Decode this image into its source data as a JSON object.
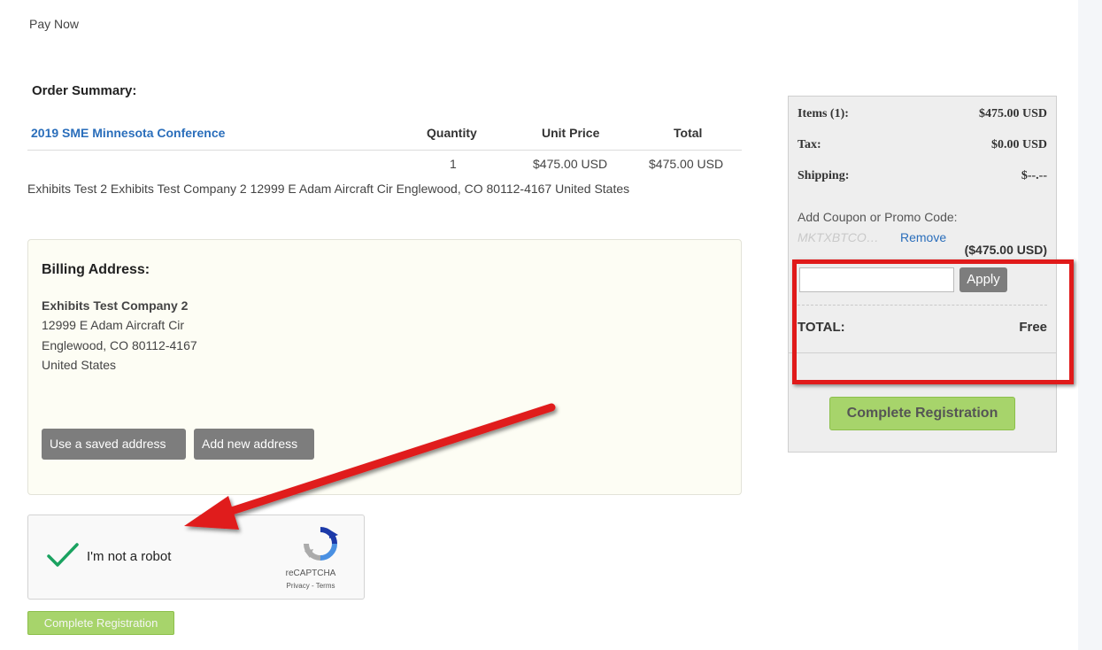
{
  "page": {
    "heading": "Pay Now",
    "accent_color": "#2a6ebb",
    "annotation_color": "#e01a1a"
  },
  "order_summary": {
    "title": "Order Summary:",
    "columns": [
      "Quantity",
      "Unit Price",
      "Total"
    ],
    "product": "2019 SME Minnesota Conference",
    "row": {
      "quantity": "1",
      "unit_price": "$475.00 USD",
      "total": "$475.00 USD"
    },
    "shipping_line": "Exhibits Test 2 Exhibits Test Company 2 12999 E Adam Aircraft Cir Englewood, CO 80112-4167 United States"
  },
  "billing": {
    "title": "Billing Address:",
    "company": "Exhibits Test Company 2",
    "lines": [
      "12999 E Adam Aircraft Cir",
      "Englewood, CO 80112-4167",
      "United States"
    ],
    "use_saved_label": "Use a saved address",
    "add_new_label": "Add new address"
  },
  "captcha": {
    "label": "I'm not a robot",
    "checked": true,
    "brand": "reCAPTCHA",
    "links": "Privacy - Terms",
    "icon": "recaptcha-logo-icon"
  },
  "bottom_button_label": "Complete Registration",
  "sidebar": {
    "items_label": "Items (1):",
    "items_value": "$475.00 USD",
    "tax_label": "Tax:",
    "tax_value": "$0.00 USD",
    "shipping_label": "Shipping:",
    "shipping_value": "$--.--",
    "coupon_label": "Add Coupon or Promo Code:",
    "coupon_code": "MKTXBTCO…",
    "remove_label": "Remove",
    "discount": "($475.00 USD)",
    "coupon_input_value": "",
    "apply_label": "Apply",
    "total_label": "TOTAL:",
    "total_value": "Free",
    "complete_label": "Complete Registration"
  }
}
